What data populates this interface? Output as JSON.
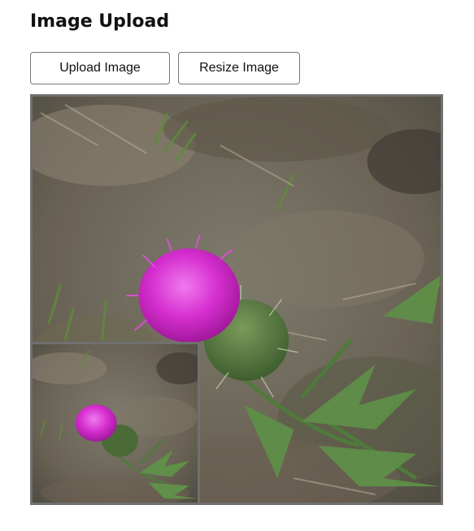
{
  "page": {
    "title": "Image Upload"
  },
  "toolbar": {
    "upload_label": "Upload Image",
    "resize_label": "Resize Image"
  },
  "preview": {
    "main_image": "thistle-flower-photo",
    "thumbnail_image": "thistle-flower-photo-resized"
  },
  "colors": {
    "frame_border": "#707070",
    "button_border": "#767676",
    "flower": "#d62fd0"
  }
}
